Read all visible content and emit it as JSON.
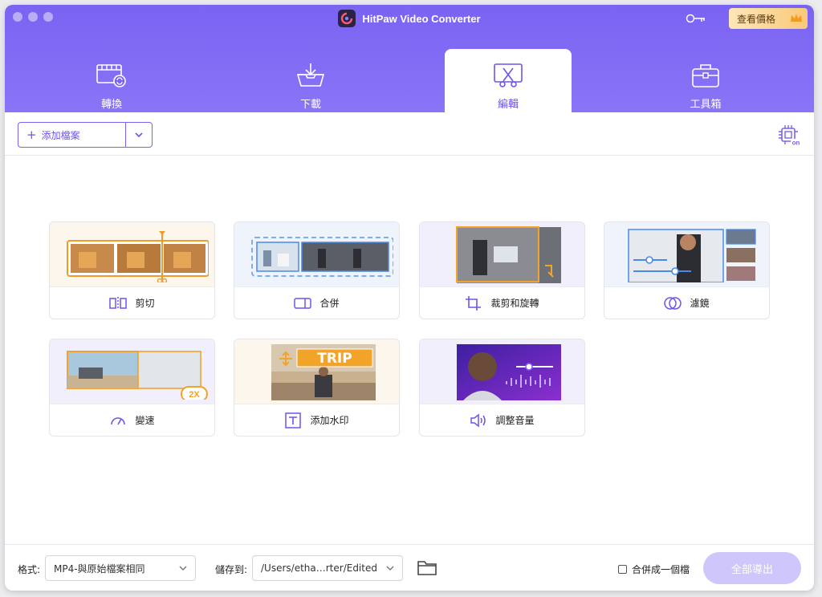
{
  "window": {
    "title": "HitPaw Video Converter",
    "price_button": "查看價格",
    "accent_color": "#7a63f2"
  },
  "tabs": [
    {
      "label": "轉換",
      "icon": "convert-icon"
    },
    {
      "label": "下載",
      "icon": "download-icon"
    },
    {
      "label": "編輯",
      "icon": "edit-icon",
      "active": true
    },
    {
      "label": "工具箱",
      "icon": "toolbox-icon"
    }
  ],
  "toolbar": {
    "add_file_label": "添加檔案"
  },
  "tools": [
    {
      "label": "剪切",
      "icon": "cut-icon"
    },
    {
      "label": "合併",
      "icon": "merge-icon"
    },
    {
      "label": "裁剪和旋轉",
      "icon": "crop-icon"
    },
    {
      "label": "濾鏡",
      "icon": "filter-icon"
    },
    {
      "label": "變速",
      "icon": "speed-icon",
      "badge": "2X"
    },
    {
      "label": "添加水印",
      "icon": "watermark-icon",
      "thumb_text": "TRIP"
    },
    {
      "label": "調整音量",
      "icon": "volume-icon"
    }
  ],
  "footer": {
    "format_label": "格式:",
    "format_value": "MP4-與原始檔案相同",
    "save_label": "儲存到:",
    "save_value": "/Users/etha…rter/Edited",
    "merge_label": "合併成一個檔",
    "export_label": "全部導出"
  }
}
